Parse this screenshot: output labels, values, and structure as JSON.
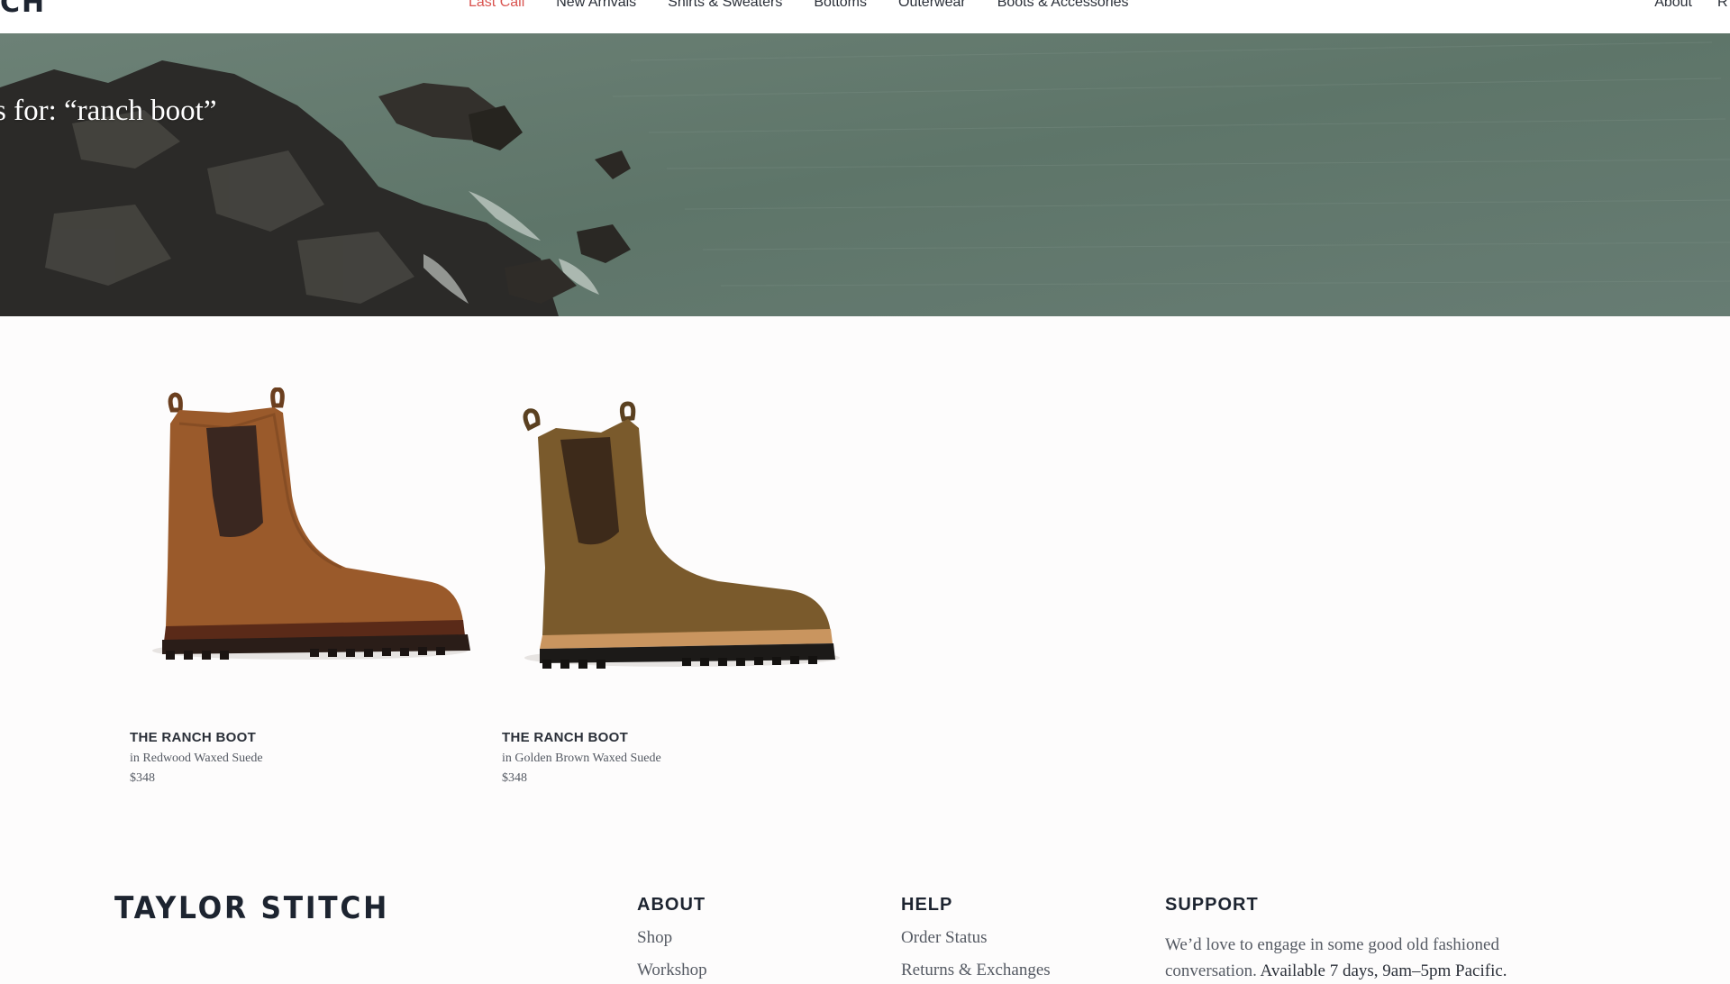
{
  "header": {
    "brand_fragment": "CH",
    "nav": [
      "Last Call",
      "New Arrivals",
      "Shirts & Sweaters",
      "Bottoms",
      "Outerwear",
      "Boots & Accessories"
    ],
    "right_links": [
      "About",
      "R"
    ]
  },
  "hero": {
    "title": "s for: “ranch boot”"
  },
  "products": [
    {
      "name": "THE RANCH BOOT",
      "variant": "in Redwood Waxed Suede",
      "price": "$348"
    },
    {
      "name": "THE RANCH BOOT",
      "variant": "in Golden Brown Waxed Suede",
      "price": "$348"
    }
  ],
  "footer": {
    "logo": "TAYLOR STITCH",
    "about": {
      "heading": "ABOUT",
      "links": [
        "Shop",
        "Workshop"
      ]
    },
    "help": {
      "heading": "HELP",
      "links": [
        "Order Status",
        "Returns & Exchanges"
      ]
    },
    "support": {
      "heading": "SUPPORT",
      "text": "We’d love to engage in some good old fashioned conversation.",
      "hours": "Available 7 days, 9am–5pm Pacific."
    }
  },
  "colors": {
    "accent": "#d9534f",
    "text_dark": "#1d2430",
    "sea": "#5f756b"
  }
}
